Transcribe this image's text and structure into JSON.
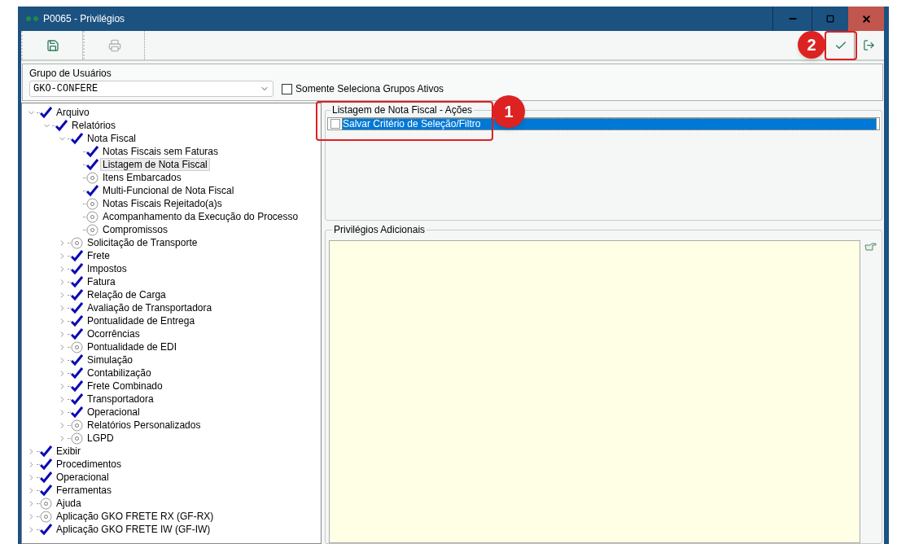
{
  "window": {
    "title": "P0065 - Privilégios"
  },
  "toolbar": [
    {
      "kind": "save",
      "disabled": false
    },
    {
      "kind": "print",
      "disabled": true
    }
  ],
  "group": {
    "label": "Grupo de Usuários",
    "value": "GKO-CONFERE",
    "filter_label": "Somente Seleciona Grupos Ativos",
    "filter_checked": false
  },
  "tree": [
    {
      "label": "Arquivo",
      "kind": "check",
      "expanded": true,
      "selected": false,
      "children": [
        {
          "label": "Relatórios",
          "kind": "check",
          "expanded": true,
          "selected": false,
          "children": [
            {
              "label": "Nota Fiscal",
              "kind": "check",
              "expanded": true,
              "selected": false,
              "children": [
                {
                  "label": "Notas Fiscais sem Faturas",
                  "kind": "check",
                  "selected": false
                },
                {
                  "label": "Listagem de Nota Fiscal",
                  "kind": "check",
                  "selected": true
                },
                {
                  "label": "Itens Embarcados",
                  "kind": "circle",
                  "selected": false
                },
                {
                  "label": "Multi-Funcional de Nota Fiscal",
                  "kind": "check",
                  "selected": false
                },
                {
                  "label": "Notas Fiscais Rejeitado(a)s",
                  "kind": "circle",
                  "selected": false
                },
                {
                  "label": "Acompanhamento da Execução do Processo",
                  "kind": "circle",
                  "selected": false
                },
                {
                  "label": "Compromissos",
                  "kind": "circle",
                  "selected": false
                }
              ]
            },
            {
              "label": "Solicitação de Transporte",
              "kind": "circle",
              "expanded": false,
              "selected": false
            },
            {
              "label": "Frete",
              "kind": "check",
              "expanded": false,
              "selected": false
            },
            {
              "label": "Impostos",
              "kind": "check",
              "expanded": false,
              "selected": false
            },
            {
              "label": "Fatura",
              "kind": "check",
              "expanded": false,
              "selected": false
            },
            {
              "label": "Relação de Carga",
              "kind": "check",
              "expanded": false,
              "selected": false
            },
            {
              "label": "Avaliação de Transportadora",
              "kind": "check",
              "expanded": false,
              "selected": false
            },
            {
              "label": "Pontualidade de Entrega",
              "kind": "check",
              "expanded": false,
              "selected": false
            },
            {
              "label": "Ocorrências",
              "kind": "check",
              "expanded": false,
              "selected": false
            },
            {
              "label": "Pontualidade de EDI",
              "kind": "circle",
              "expanded": false,
              "selected": false
            },
            {
              "label": "Simulação",
              "kind": "check",
              "expanded": false,
              "selected": false
            },
            {
              "label": "Contabilização",
              "kind": "check",
              "expanded": false,
              "selected": false
            },
            {
              "label": "Frete Combinado",
              "kind": "check",
              "expanded": false,
              "selected": false
            },
            {
              "label": "Transportadora",
              "kind": "check",
              "expanded": false,
              "selected": false
            },
            {
              "label": "Operacional",
              "kind": "check",
              "expanded": false,
              "selected": false
            },
            {
              "label": "Relatórios Personalizados",
              "kind": "circle",
              "expanded": false,
              "selected": false
            },
            {
              "label": "LGPD",
              "kind": "circle",
              "expanded": false,
              "selected": false
            }
          ]
        }
      ]
    },
    {
      "label": "Exibir",
      "kind": "check",
      "expanded": false,
      "selected": false
    },
    {
      "label": "Procedimentos",
      "kind": "check",
      "expanded": false,
      "selected": false
    },
    {
      "label": "Operacional",
      "kind": "check",
      "expanded": false,
      "selected": false
    },
    {
      "label": "Ferramentas",
      "kind": "check",
      "expanded": false,
      "selected": false
    },
    {
      "label": "Ajuda",
      "kind": "circle",
      "expanded": false,
      "selected": false
    },
    {
      "label": "Aplicação GKO FRETE RX (GF-RX)",
      "kind": "circle",
      "expanded": false,
      "selected": false
    },
    {
      "label": "Aplicação GKO FRETE IW (GF-IW)",
      "kind": "check",
      "expanded": false,
      "selected": false
    }
  ],
  "actions": {
    "title": "Listagem de Nota Fiscal - Ações",
    "items": [
      {
        "label": "Salvar Critério de Seleção/Filtro",
        "checked": false,
        "selected": true
      }
    ]
  },
  "additional": {
    "title": "Privilégios Adicionais"
  },
  "callouts": [
    {
      "number": "1"
    },
    {
      "number": "2"
    }
  ]
}
